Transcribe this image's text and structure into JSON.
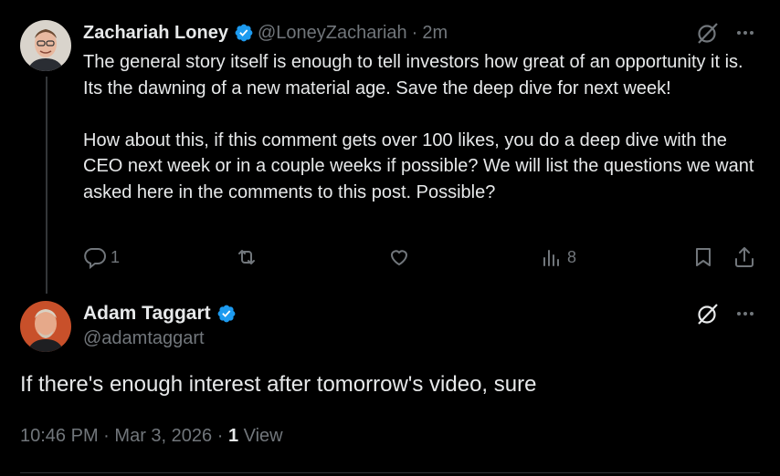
{
  "reply": {
    "author_name": "Zachariah Loney",
    "handle": "@LoneyZachariah",
    "separator": "·",
    "time": "2m",
    "paragraphs": [
      "The general story itself is enough to tell investors how great of an opportunity it is. Its the dawning of a new material age. Save the deep dive for next week!",
      "How about this, if this comment gets over 100 likes, you do a deep dive with the CEO next week or in a couple weeks if possible? We will list the questions we want asked here in the comments to this post. Possible?"
    ],
    "reply_count": "1",
    "views_count": "8"
  },
  "main": {
    "author_name": "Adam Taggart",
    "handle": "@adamtaggart",
    "text": "If there's enough interest after tomorrow's video, sure",
    "time": "10:46 PM",
    "dot": "·",
    "date": "Mar 3, 2026",
    "view_count": "1",
    "view_label": "View"
  },
  "colors": {
    "background": "#000000",
    "text": "#e7e9ea",
    "muted": "#71767b",
    "verified": "#1d9bf0",
    "divider": "#2f3336"
  },
  "icons": [
    "grok-icon",
    "more-icon",
    "reply-icon",
    "retweet-icon",
    "like-icon",
    "views-icon",
    "bookmark-icon",
    "share-icon",
    "verified-badge-icon"
  ]
}
